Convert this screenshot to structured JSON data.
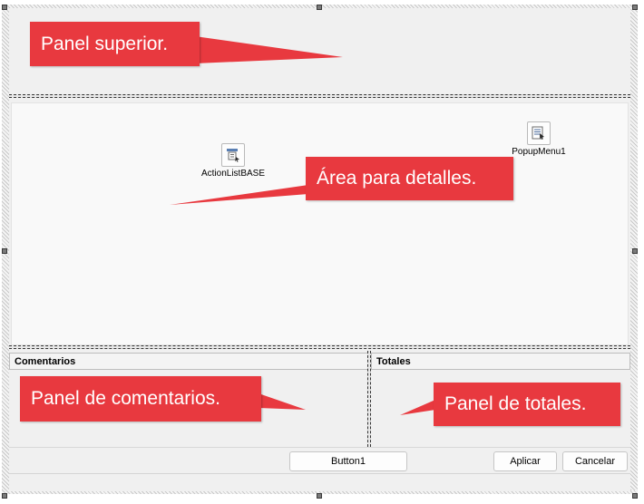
{
  "callouts": {
    "top_panel": "Panel superior.",
    "detail_area": "Área para detalles.",
    "comments_panel": "Panel de comentarios.",
    "totals_panel": "Panel de totales."
  },
  "components": {
    "action_list": "ActionListBASE",
    "popup_menu": "PopupMenu1"
  },
  "panels": {
    "comments_header": "Comentarios",
    "totals_header": "Totales"
  },
  "buttons": {
    "button1": "Button1",
    "apply": "Aplicar",
    "cancel": "Cancelar"
  },
  "colors": {
    "callout": "#e8393f",
    "panel": "#f0f0f0",
    "detail": "#f9f9f9"
  },
  "icons": {
    "action_list": "action-list-icon",
    "popup_menu": "popup-menu-icon"
  }
}
